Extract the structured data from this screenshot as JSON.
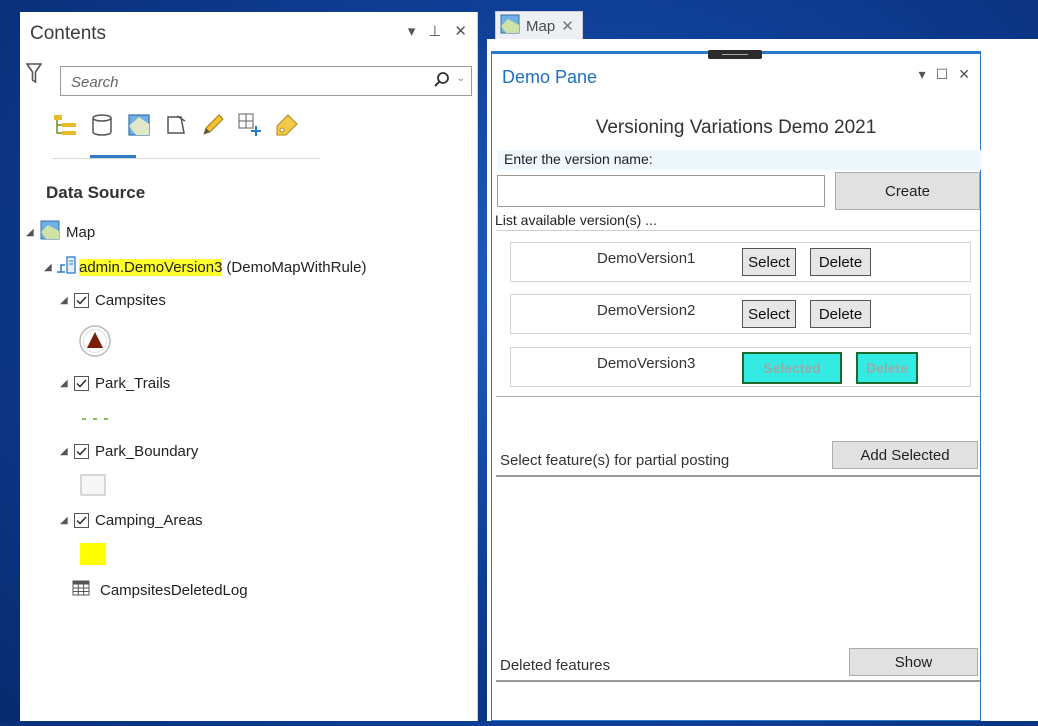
{
  "contents": {
    "title": "Contents",
    "controls": [
      "▾",
      "⊥",
      "✕"
    ],
    "search_placeholder": "Search",
    "section_title": "Data Source",
    "map_label": "Map",
    "version_label": "admin.DemoVersion3",
    "version_suffix": "(DemoMapWithRule)",
    "layers": [
      {
        "name": "Campsites"
      },
      {
        "name": "Park_Trails"
      },
      {
        "name": "Park_Boundary"
      },
      {
        "name": "Camping_Areas"
      }
    ],
    "table_name": "CampsitesDeletedLog"
  },
  "map_tab": {
    "label": "Map",
    "close": "✕"
  },
  "demo_pane": {
    "title": "Demo Pane",
    "controls": [
      "▾",
      "☐",
      "✕"
    ],
    "heading": "Versioning Variations Demo 2021",
    "version_name_label": "Enter the version name:",
    "version_name_value": "",
    "create_label": "Create",
    "list_label": "List available version(s) ...",
    "versions": [
      {
        "name": "DemoVersion1",
        "select_label": "Select",
        "delete_label": "Delete",
        "selected": false
      },
      {
        "name": "DemoVersion2",
        "select_label": "Select",
        "delete_label": "Delete",
        "selected": false
      },
      {
        "name": "DemoVersion3",
        "select_label": "Selected",
        "delete_label": "Delete",
        "selected": true
      }
    ],
    "partial_label": "Select feature(s) for partial posting",
    "add_selected_label": "Add Selected",
    "deleted_label": "Deleted features",
    "show_label": "Show"
  },
  "colors": {
    "highlight": "#ffff2e",
    "accent": "#2a7bc9",
    "selected_button": "#33ebe3",
    "camping_area_fill": "#ffff00"
  }
}
